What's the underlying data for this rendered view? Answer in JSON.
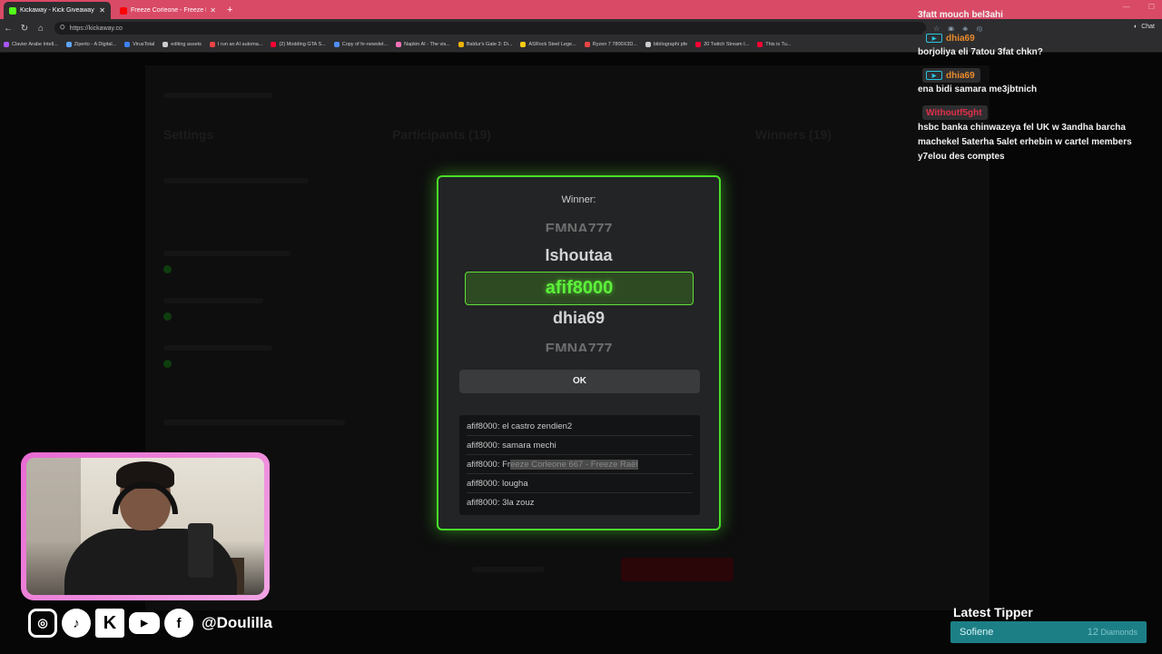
{
  "browser": {
    "tabs": [
      {
        "title": "Kickaway - Kick Giveaway Tool",
        "color": "#53fc18",
        "active": true
      },
      {
        "title": "Freeze Corleone - Freeze Raël (fo...",
        "color": "#ff0000",
        "active": false
      }
    ],
    "url": "https://kickaway.co",
    "chat_button": "Chat",
    "bookmarks": [
      {
        "label": "Clavier Arabe Intell...",
        "color": "#a855f7"
      },
      {
        "label": "Ziperto - A Digital...",
        "color": "#60a5fa"
      },
      {
        "label": "VirusTotal",
        "color": "#3b82f6"
      },
      {
        "label": "editing assets",
        "color": "#cccccc"
      },
      {
        "label": "I run an AI automa...",
        "color": "#ef4444"
      },
      {
        "label": "(2) Modding GTA S...",
        "color": "#ff0033"
      },
      {
        "label": "Copy of hr-newslet...",
        "color": "#4f8ef7"
      },
      {
        "label": "Napkin AI - The vis...",
        "color": "#f472b6"
      },
      {
        "label": "Baldur's Gate 3: Di...",
        "color": "#eab308"
      },
      {
        "label": "ASRock Steel Lege...",
        "color": "#facc15"
      },
      {
        "label": "Ryzen 7 7800X3D...",
        "color": "#ef4444"
      },
      {
        "label": "bibliographi pfe",
        "color": "#cccccc"
      },
      {
        "label": "20 Twitch Stream I...",
        "color": "#ff0033"
      },
      {
        "label": "This is Tu...",
        "color": "#ff0033"
      }
    ]
  },
  "modal": {
    "winner_label": "Winner:",
    "names": {
      "top_faded": "EMNA777",
      "above": "Ishoutaa",
      "winner": "afif8000",
      "below": "dhia69",
      "bottom_faded": "EMNA777"
    },
    "ok_label": "OK",
    "messages": [
      {
        "user": "afif8000",
        "text": "el castro zendien2"
      },
      {
        "user": "afif8000",
        "text": "samara mechi"
      },
      {
        "user": "afif8000",
        "prefix": "Fr",
        "highlight": "eeze Corleone 667 - Freeze Raël"
      },
      {
        "user": "afif8000",
        "text": "lougha"
      },
      {
        "user": "afif8000",
        "text": "3la zouz"
      }
    ]
  },
  "chat": {
    "top_partial": "3fatt mouch bel3ahi",
    "entries": [
      {
        "user": "dhia69",
        "user_color": "#e98b2c",
        "badge": true,
        "message": "borjoliya eli 7atou 3fat chkn?"
      },
      {
        "user": "dhia69",
        "user_color": "#e98b2c",
        "badge": true,
        "message": "ena bidi samara me3jbtnich"
      },
      {
        "user": "Withoutf5ght",
        "user_color": "#e0304a",
        "badge": false,
        "message": "hsbc banka chinwazeya fel UK w 3andha barcha machekel 5aterha 5alet erhebin w cartel members y7elou des comptes"
      }
    ]
  },
  "socials": {
    "handle": "@Doulilla",
    "icons": [
      "instagram-icon",
      "tiktok-icon",
      "kick-icon",
      "youtube-icon",
      "facebook-icon"
    ]
  },
  "tipper": {
    "title": "Latest Tipper",
    "name": "Sofiene",
    "amount": "12",
    "unit": "Diamonds"
  }
}
